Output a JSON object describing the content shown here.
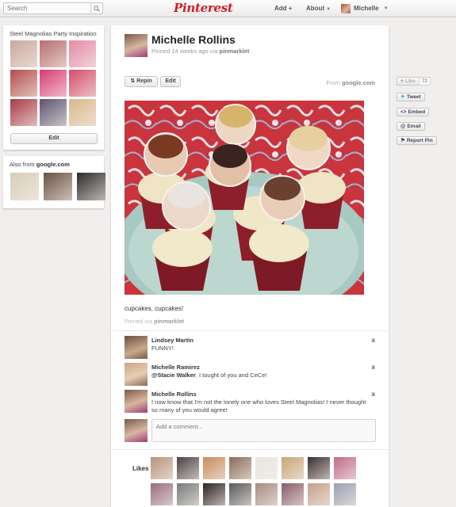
{
  "header": {
    "search_placeholder": "Search",
    "logo": "Pinterest",
    "add_label": "Add",
    "about_label": "About",
    "user_label": "Michelle"
  },
  "board": {
    "title": "Steel Magnolias Party Inspiration",
    "edit_label": "Edit",
    "thumb_colors": [
      "#c9a79a",
      "#b86d6f",
      "#e58aa8",
      "#b24c4c",
      "#d93a74",
      "#d44d6a",
      "#a83a48",
      "#5c5470",
      "#d9b78a"
    ]
  },
  "also_from": {
    "prefix": "Also from",
    "site": "google.com",
    "thumb_colors": [
      "#d8cdb8",
      "#6b5042",
      "#2b2a2a"
    ]
  },
  "pin": {
    "pinner_name": "Michelle Rollins",
    "pinned_prefix": "Pinned 14 weeks ago via",
    "pinned_via": "pinmarklet",
    "repin_label": "Repin",
    "edit_label": "Edit",
    "from_prefix": "From",
    "from_site": "google.com",
    "description": "cupcakes, cupcakes!",
    "via_prefix": "Pinned via",
    "via_name": "pinmarklet"
  },
  "comments": [
    {
      "name": "Lindsey Martin",
      "mention": "",
      "text": "FUNNY!",
      "avatar_color": "#a37a63"
    },
    {
      "name": "Michelle Ramirez",
      "mention": "@Stacie Walker",
      "text": ", I tought of you and CeCe!",
      "avatar_color": "#c49a7a"
    },
    {
      "name": "Michelle Rollins",
      "mention": "",
      "text": "I now know that I'm not the lonely one who loves Steel Magnolias! I never thought so many of you would agree!",
      "avatar_color": "#9a6a6a"
    }
  ],
  "comment_close": "x",
  "add_comment_placeholder": "Add a comment...",
  "likes": {
    "label": "Likes",
    "avatar_colors": [
      "#b9937a",
      "#4a4242",
      "#c78c5c",
      "#8b6b5a",
      "#e9e5e0",
      "#c9a477",
      "#3a2e2e",
      "#c06a8a",
      "#9a6b7d",
      "#7a7a7a",
      "#2e2222",
      "#5a5a5a",
      "#a88a80",
      "#8a5a6a",
      "#c4a08a",
      "#9aa0b0"
    ]
  },
  "side_actions": {
    "like_label": "Like",
    "like_count": "72",
    "tweet_label": "Tweet",
    "embed_label": "Embed",
    "email_label": "Email",
    "report_label": "Report Pin"
  },
  "colors": {
    "brand_red": "#cb2027",
    "page_bg": "#f1eeee",
    "tweet_blue": "#2aa3df"
  }
}
